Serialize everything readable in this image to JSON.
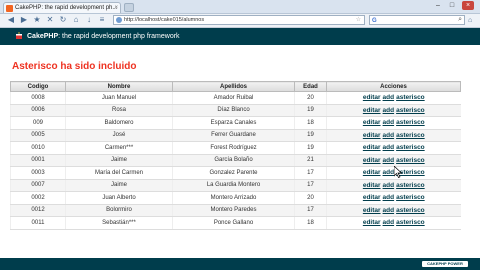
{
  "browser": {
    "tab_title": "CakePHP: the rapid development ph...",
    "url": "http://localhost/cake015/alumnos"
  },
  "app": {
    "header_title": "CakePHP: the rapid development php framework",
    "header_brand": "CakePHP",
    "header_rest": ": the rapid development php framework",
    "footer_badge": "CAKEPHP POWER"
  },
  "page": {
    "heading": "Asterisco ha sido incluido"
  },
  "table": {
    "headers": [
      "Codigo",
      "Nombre",
      "Apellidos",
      "Edad",
      "Acciones"
    ],
    "action_labels": [
      "editar",
      "add",
      "asterisco"
    ],
    "rows": [
      {
        "codigo": "0008",
        "nombre": "Juan Manuel",
        "apellidos": "Amador Ruibal",
        "edad": "20"
      },
      {
        "codigo": "0006",
        "nombre": "Rosa",
        "apellidos": "Díaz Blanco",
        "edad": "19"
      },
      {
        "codigo": "009",
        "nombre": "Baldomero",
        "apellidos": "Esparza Canales",
        "edad": "18"
      },
      {
        "codigo": "0005",
        "nombre": "José",
        "apellidos": "Ferrer Guardane",
        "edad": "19"
      },
      {
        "codigo": "0010",
        "nombre": "Carmen***",
        "apellidos": "Forest Rodríguez",
        "edad": "19"
      },
      {
        "codigo": "0001",
        "nombre": "Jaime",
        "apellidos": "García Bolaño",
        "edad": "21"
      },
      {
        "codigo": "0003",
        "nombre": "María del Carmen",
        "apellidos": "Gonzalez Parente",
        "edad": "17"
      },
      {
        "codigo": "0007",
        "nombre": "Jaime",
        "apellidos": "La Guardia Montero",
        "edad": "17"
      },
      {
        "codigo": "0002",
        "nombre": "Juan Alberto",
        "apellidos": "Montero Arrizado",
        "edad": "20"
      },
      {
        "codigo": "0012",
        "nombre": "Bolormiro",
        "apellidos": "Montero Paredes",
        "edad": "17"
      },
      {
        "codigo": "0011",
        "nombre": "Sebastián***",
        "apellidos": "Ponce Gallano",
        "edad": "18"
      }
    ]
  },
  "colors": {
    "header_bg": "#003d4c",
    "heading_red": "#e32",
    "link": "#003d4c"
  }
}
